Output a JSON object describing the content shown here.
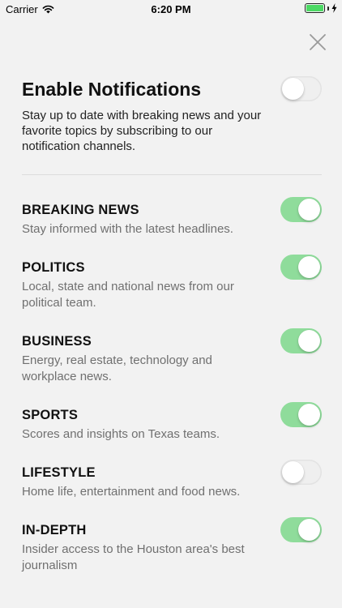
{
  "status_bar": {
    "carrier": "Carrier",
    "time": "6:20 PM",
    "battery_level": 1.0
  },
  "header": {
    "close_icon": "close-icon"
  },
  "master": {
    "title": "Enable Notifications",
    "description": "Stay up to date with breaking news and your favorite topics by subscribing to our notification channels.",
    "enabled": false
  },
  "channels": [
    {
      "title": "BREAKING NEWS",
      "description": "Stay informed with the latest headlines.",
      "enabled": true
    },
    {
      "title": "POLITICS",
      "description": "Local, state and national news from our political team.",
      "enabled": true
    },
    {
      "title": "BUSINESS",
      "description": "Energy, real estate, technology and workplace news.",
      "enabled": true
    },
    {
      "title": "SPORTS",
      "description": "Scores and insights on Texas teams.",
      "enabled": true
    },
    {
      "title": "LIFESTYLE",
      "description": "Home life, entertainment and food news.",
      "enabled": false
    },
    {
      "title": "IN-DEPTH",
      "description": "Insider access to the Houston area's best journalism",
      "enabled": true
    }
  ],
  "colors": {
    "toggle_on": "#8fdc9b",
    "toggle_off": "#efefef",
    "background": "#f2f2f2",
    "battery": "#4cd964"
  }
}
